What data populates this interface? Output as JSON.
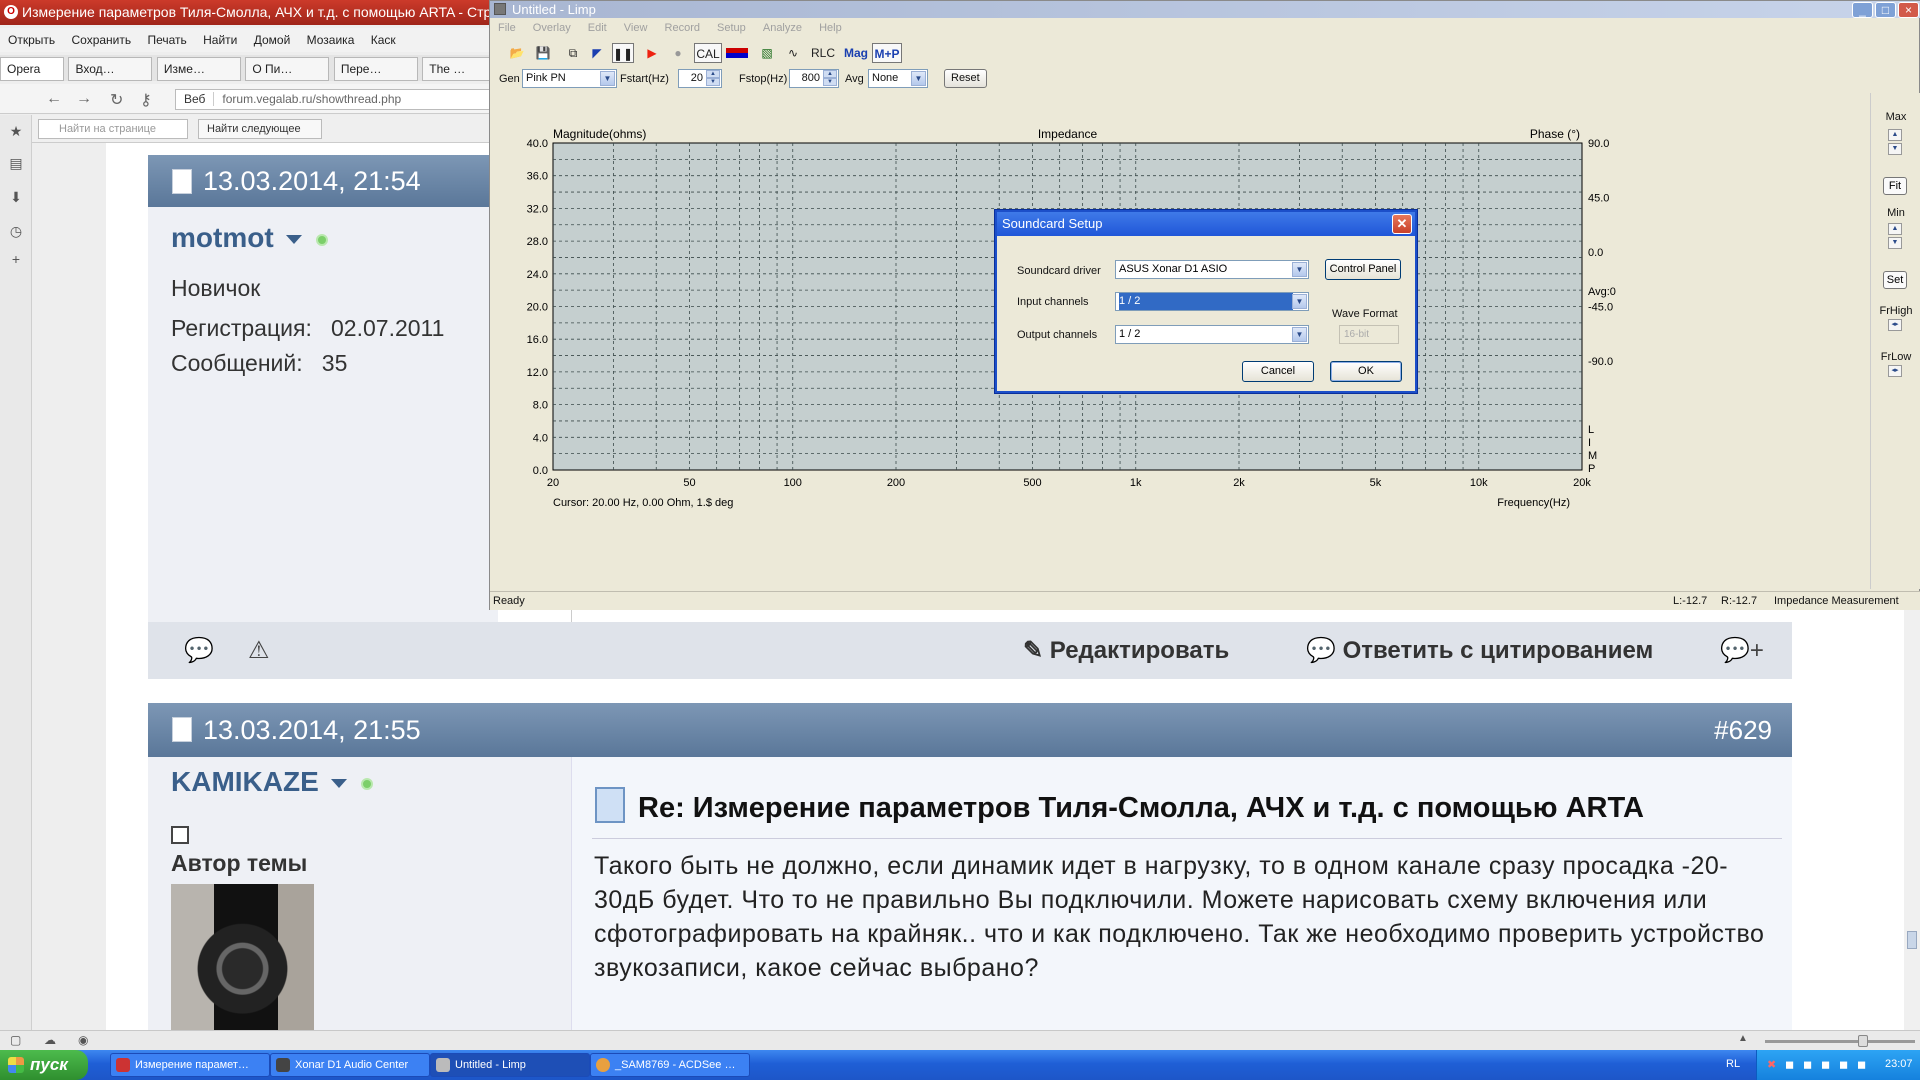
{
  "browser": {
    "title": "Измерение параметров Тиля-Смолла, АЧХ и т.д. с помощью ARTA - Стр",
    "menu": [
      "Открыть",
      "Сохранить",
      "Печать",
      "Найти",
      "Домой",
      "Мозаика",
      "Каск"
    ],
    "tabs": [
      "Opera",
      "Вход…",
      "Изме…",
      "О Пи…",
      "Пере…",
      "The …"
    ],
    "url_site": "Веб",
    "url": "forum.vegalab.ru/showthread.php",
    "find_placeholder": "Найти на странице",
    "find_next": "Найти следующее"
  },
  "post1": {
    "date": "13.03.2014, 21:54",
    "username": "motmot",
    "rank": "Новичок",
    "reg_label": "Регистрация:",
    "reg_date": "02.07.2011",
    "msgs_label": "Сообщений:",
    "msgs_count": "35",
    "edit_label": "Редактировать",
    "quote_label": "Ответить с цитированием"
  },
  "post2": {
    "date": "13.03.2014, 21:55",
    "number": "#629",
    "username": "KAMIKAZE",
    "role": "Автор темы",
    "title": "Re: Измерение параметров Тиля-Смолла, АЧХ и т.д. с помощью ARTA",
    "text": "Такого быть не должно, если динамик идет в нагрузку, то в одном канале сразу просадка -20-30дБ будет. Что то не правильно Вы подключили. Можете нарисовать схему включения или сфотографировать на крайняк.. что и как подключено. Так же необходимо проверить устройство звукозаписи, какое сейчас выбрано?"
  },
  "limp": {
    "title": "Untitled - Limp",
    "menu": [
      "File",
      "Overlay",
      "Edit",
      "View",
      "Record",
      "Setup",
      "Analyze",
      "Help"
    ],
    "toolbar_text": {
      "cal": "CAL",
      "rlc": "RLC",
      "mag": "Mag",
      "mp": "M+P"
    },
    "gen_label": "Gen",
    "gen_value": "Pink PN",
    "fstart_label": "Fstart(Hz)",
    "fstart_value": "20",
    "fstop_label": "Fstop(Hz)",
    "fstop_value": "800",
    "avg_label": "Avg",
    "avg_value": "None",
    "reset": "Reset",
    "right_panel": {
      "max": "Max",
      "fit": "Fit",
      "min": "Min",
      "set": "Set",
      "frhigh": "FrHigh",
      "frlow": "FrLow"
    },
    "status": {
      "ready": "Ready",
      "l": "L:-12.7",
      "r": "R:-12.7",
      "mode": "Impedance Measurement"
    }
  },
  "chart_data": {
    "type": "line",
    "title": "Impedance",
    "ylabel": "Magnitude(ohms)",
    "y2label": "Phase (°)",
    "xlabel": "Frequency(Hz)",
    "x_scale": "log",
    "xlim": [
      20,
      20000
    ],
    "ylim": [
      0,
      40
    ],
    "y2lim": [
      -180,
      90
    ],
    "grid": true,
    "background": "#c5cfcf",
    "yticks": [
      "0.0",
      "4.0",
      "8.0",
      "12.0",
      "16.0",
      "20.0",
      "24.0",
      "28.0",
      "32.0",
      "36.0",
      "40.0"
    ],
    "y2ticks": [
      "90.0",
      "45.0",
      "0.0",
      "-45.0",
      "-90.0"
    ],
    "y2note": "Avg:0",
    "xtick_values": [
      20,
      50,
      100,
      200,
      500,
      1000,
      2000,
      5000,
      10000,
      20000
    ],
    "xticks": [
      "20",
      "50",
      "100",
      "200",
      "500",
      "1k",
      "2k",
      "5k",
      "10k",
      "20k"
    ],
    "side_label": [
      "L",
      "I",
      "M",
      "P"
    ],
    "cursor": "Cursor: 20.00 Hz, 0.00 Ohm, 1.$ deg",
    "series": []
  },
  "dialog": {
    "title": "Soundcard Setup",
    "driver_label": "Soundcard driver",
    "driver_value": "ASUS Xonar D1 ASIO",
    "control_panel": "Control Panel",
    "input_label": "Input channels",
    "input_value": "1 / 2",
    "output_label": "Output channels",
    "output_value": "1 / 2",
    "wave_label": "Wave Format",
    "wave_value": "16-bit",
    "cancel": "Cancel",
    "ok": "OK"
  },
  "taskbar": {
    "start": "пуск",
    "tasks": [
      "Измерение парамет…",
      "Xonar D1 Audio Center",
      "Untitled - Limp",
      "_SAM8769 - ACDSee …"
    ],
    "lang": "RL",
    "clock": "23:07"
  }
}
